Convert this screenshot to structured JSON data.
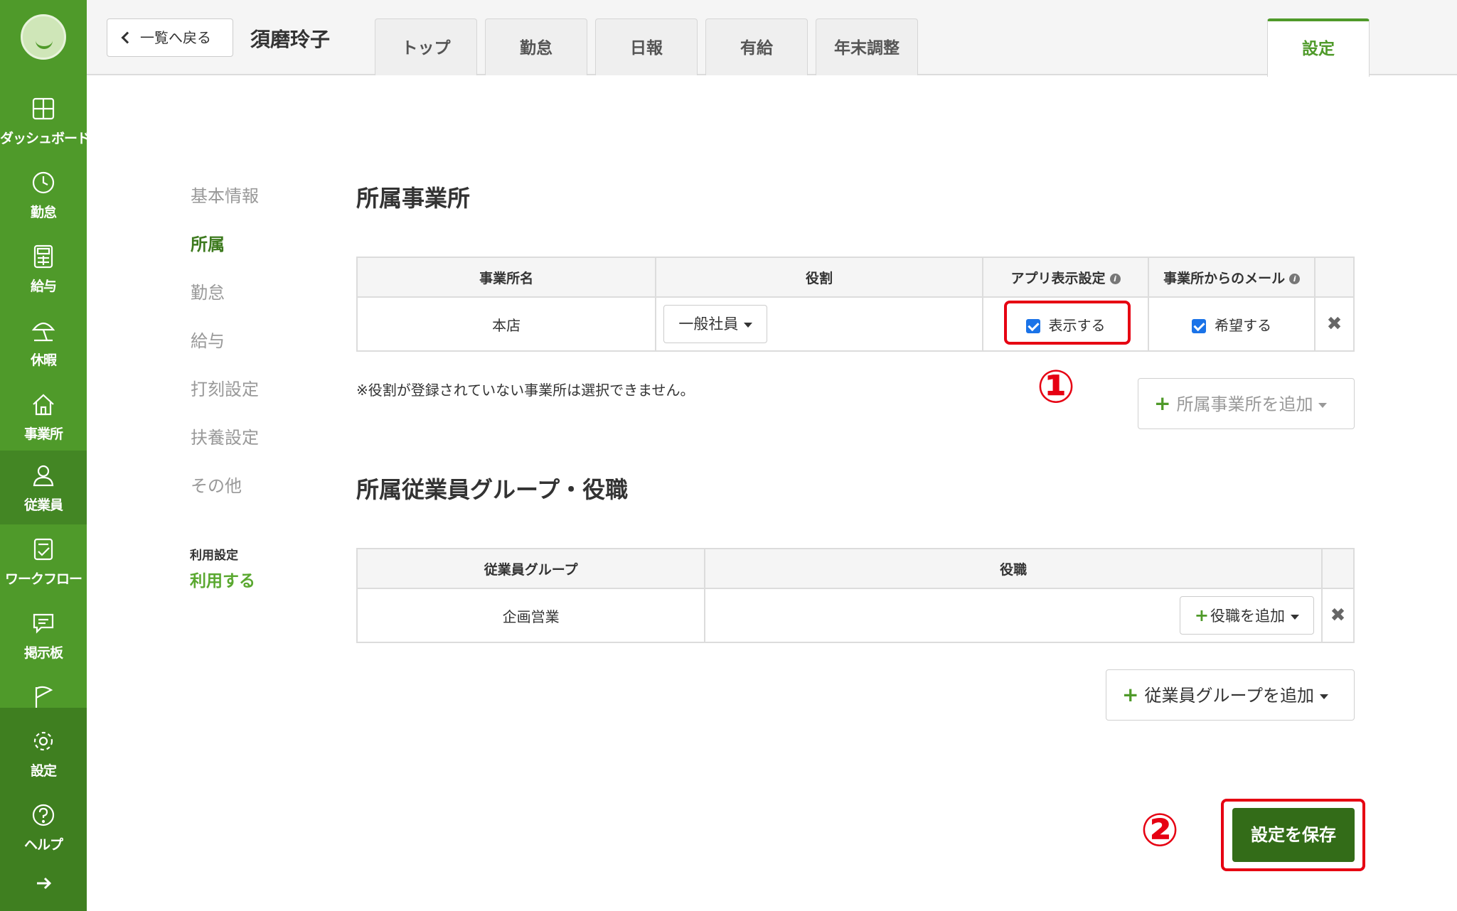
{
  "sidebar": {
    "items": [
      {
        "label": "ダッシュボード",
        "icon": "dashboard-icon"
      },
      {
        "label": "勤怠",
        "icon": "clock-icon"
      },
      {
        "label": "給与",
        "icon": "calculator-icon"
      },
      {
        "label": "休暇",
        "icon": "beach-umbrella-icon"
      },
      {
        "label": "事業所",
        "icon": "home-icon"
      },
      {
        "label": "従業員",
        "icon": "person-icon"
      },
      {
        "label": "ワークフロー",
        "icon": "checklist-icon"
      },
      {
        "label": "掲示板",
        "icon": "chat-icon"
      },
      {
        "label": "設定",
        "icon": "gear-icon"
      },
      {
        "label": "ヘルプ",
        "icon": "help-icon"
      }
    ],
    "active": "従業員"
  },
  "header": {
    "back_label": "一覧へ戻る",
    "employee_name": "須磨玲子",
    "tabs": [
      {
        "label": "トップ"
      },
      {
        "label": "勤怠"
      },
      {
        "label": "日報"
      },
      {
        "label": "有給"
      },
      {
        "label": "年末調整"
      },
      {
        "label": "設定"
      }
    ],
    "active_tab": "設定"
  },
  "settings_nav": {
    "items": [
      "基本情報",
      "所属",
      "勤怠",
      "給与",
      "打刻設定",
      "扶養設定",
      "その他"
    ],
    "active": "所属",
    "usage_label": "利用設定",
    "usage_value": "利用する"
  },
  "office_section": {
    "title": "所属事業所",
    "columns": [
      "事業所名",
      "役割",
      "アプリ表示設定",
      "事業所からのメール"
    ],
    "rows": [
      {
        "office": "本店",
        "role": "一般社員",
        "app_display": "表示する",
        "mail": "希望する"
      }
    ],
    "note": "※役割が登録されていない事業所は選択できません。",
    "add_label": "所属事業所を追加"
  },
  "group_section": {
    "title": "所属従業員グループ・役職",
    "columns": [
      "従業員グループ",
      "役職"
    ],
    "rows": [
      {
        "group": "企画営業",
        "add_position_label": "役職を追加"
      }
    ],
    "add_label": "従業員グループを追加"
  },
  "annotations": {
    "marker1": "①",
    "marker2": "②",
    "highlight_color": "#e60012"
  },
  "save_label": "設定を保存",
  "colors": {
    "brand_green": "#4f9a2a",
    "dark_green": "#336c18",
    "checkbox_blue": "#1a73e8"
  }
}
